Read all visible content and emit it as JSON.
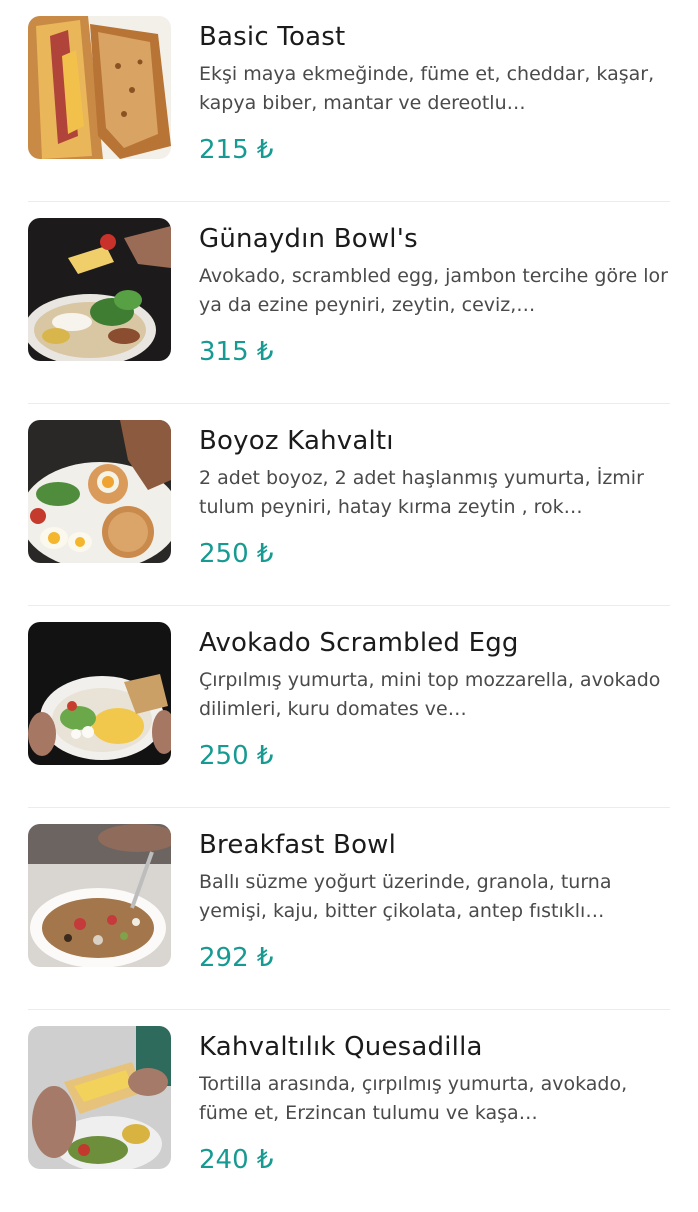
{
  "currency": "₺",
  "items": [
    {
      "name": "Basic Toast",
      "description": "Ekşi maya ekmeğinde, füme et, cheddar, kaşar, kapya biber, mantar ve dereotlu…",
      "price": "215 ₺",
      "image_icon": "toast-photo"
    },
    {
      "name": "Günaydın Bowl's",
      "description": "Avokado, scrambled egg, jambon tercihe göre lor ya da ezine peyniri, zeytin, ceviz,…",
      "price": "315 ₺",
      "image_icon": "bowl-photo"
    },
    {
      "name": "Boyoz Kahvaltı",
      "description": "2 adet boyoz, 2 adet haşlanmış yumurta, İzmir tulum peyniri, hatay kırma zeytin , rok…",
      "price": "250 ₺",
      "image_icon": "breakfast-plate-photo"
    },
    {
      "name": "Avokado Scrambled Egg",
      "description": "Çırpılmış yumurta, mini top mozzarella, avokado dilimleri, kuru domates ve…",
      "price": "250 ₺",
      "image_icon": "scrambled-egg-bowl-photo"
    },
    {
      "name": "Breakfast Bowl",
      "description": "Ballı süzme yoğurt üzerinde, granola, turna yemişi, kaju, bitter çikolata, antep fıstıklı…",
      "price": "292 ₺",
      "image_icon": "granola-bowl-photo"
    },
    {
      "name": "Kahvaltılık Quesadilla",
      "description": "Tortilla arasında, çırpılmış yumurta, avokado, füme et, Erzincan tulumu ve kaşa…",
      "price": "240 ₺",
      "image_icon": "quesadilla-photo"
    }
  ]
}
